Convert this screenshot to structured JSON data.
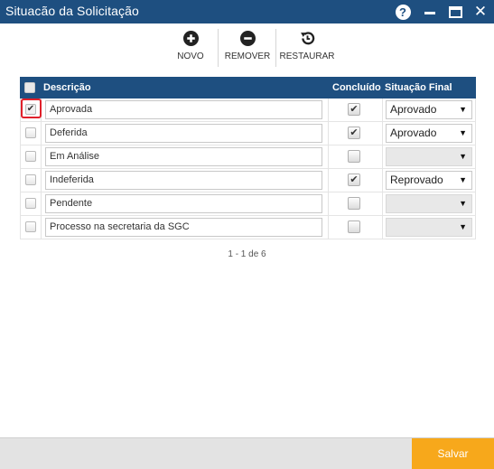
{
  "window": {
    "title": "Situacão da Solicitação"
  },
  "toolbar": {
    "novo": "NOVO",
    "remover": "REMOVER",
    "restaurar": "RESTAURAR"
  },
  "grid": {
    "headers": {
      "descricao": "Descrição",
      "concluido": "Concluído",
      "situacao_final": "Situação Final"
    },
    "rows": [
      {
        "selected": true,
        "descricao": "Aprovada",
        "concluido": true,
        "situacao_final": "Aprovado"
      },
      {
        "selected": false,
        "descricao": "Deferida",
        "concluido": true,
        "situacao_final": "Aprovado"
      },
      {
        "selected": false,
        "descricao": "Em Análise",
        "concluido": false,
        "situacao_final": ""
      },
      {
        "selected": false,
        "descricao": "Indeferida",
        "concluido": true,
        "situacao_final": "Reprovado"
      },
      {
        "selected": false,
        "descricao": "Pendente",
        "concluido": false,
        "situacao_final": ""
      },
      {
        "selected": false,
        "descricao": "Processo na secretaria da SGC",
        "concluido": false,
        "situacao_final": ""
      }
    ]
  },
  "pager": {
    "text": "1 - 1 de 6"
  },
  "footer": {
    "save_label": "Salvar"
  },
  "colors": {
    "header_blue": "#1e4f80",
    "save_orange": "#f7a81b",
    "highlight_red": "#e0202a"
  }
}
